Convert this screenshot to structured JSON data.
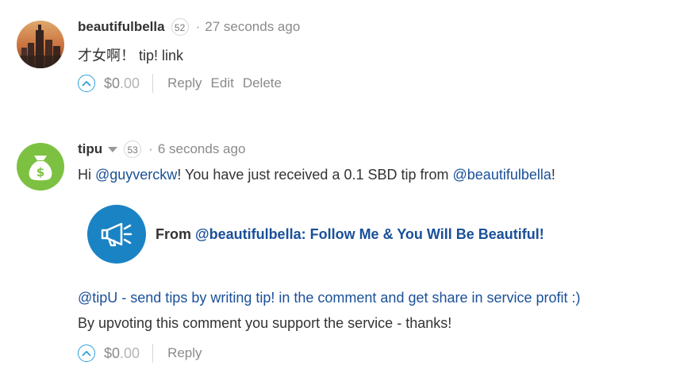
{
  "comments": [
    {
      "author": "beautifulbella",
      "reputation": "52",
      "separator": "·",
      "time": "27 seconds ago",
      "body": "才女啊！ tip! link",
      "payout_currency": "$",
      "payout_int": "0",
      "payout_dec": ".00",
      "actions": [
        "Reply",
        "Edit",
        "Delete"
      ],
      "avatar_icon": "city-skyline-avatar"
    },
    {
      "author": "tipu",
      "reputation": "53",
      "separator": "·",
      "time": "6 seconds ago",
      "body_parts": [
        "Hi ",
        "@guyverckw",
        "! You have just received a 0.1 SBD tip from ",
        "@beautifulbella",
        "!"
      ],
      "card": {
        "from_label": "From ",
        "from_link": "@beautifulbella: Follow Me & You Will Be Beautiful!",
        "icon": "megaphone-icon"
      },
      "line_promo": "@tipU - send tips by writing tip! in the comment and get share in service profit :)",
      "line_thanks": "By upvoting this comment you support the service - thanks!",
      "payout_currency": "$",
      "payout_int": "0",
      "payout_dec": ".00",
      "actions": [
        "Reply"
      ],
      "avatar_icon": "money-bag-icon"
    }
  ],
  "colors": {
    "link": "#1a5099",
    "upvote": "#2f9fd9",
    "tipu_avatar": "#7cc141",
    "card_logo": "#1a83c4"
  }
}
